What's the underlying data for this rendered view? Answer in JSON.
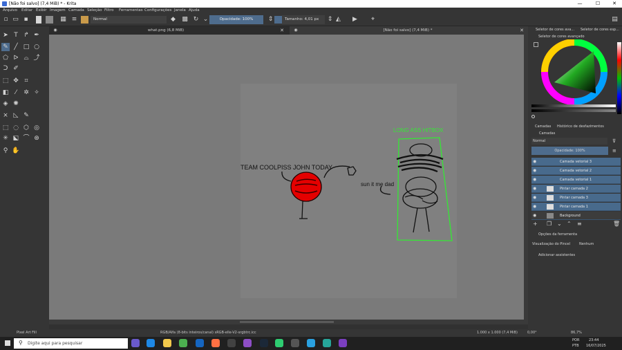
{
  "window": {
    "title": "[Não foi salvo]  (7,4 MiB)  * - Krita",
    "minimize": "—",
    "maximize": "☐",
    "close": "✕"
  },
  "menu": [
    "Arquivo",
    "Editar",
    "Exibir",
    "Imagem",
    "Camada",
    "Seleção",
    "Filtro",
    "Ferramentas",
    "Configurações",
    "Janela",
    "Ajuda"
  ],
  "toolbar": {
    "blend_mode": "Normal",
    "opacity": "Opacidade: 100%",
    "size": "Tamanho: 4,01 px"
  },
  "documents": {
    "tab1": "what.png (6,8 MiB)",
    "tab2": "[Não foi salvo]  (7,4 MiB) *"
  },
  "drawing": {
    "text_team": "TEAM COOLPISS JOHN TODAY",
    "text_sun": "sun it me dad",
    "text_hitbox": "LONG ASS HITBOX",
    "hitbox_color": "#34e834",
    "ball_color": "#e40000"
  },
  "panel": {
    "color_tabs": [
      "Seletor de cores ava...",
      "Seletor de cores esp..."
    ],
    "advanced_selector": "Seletor de cores avançado",
    "layers_tabs": [
      "Camadas",
      "Histórico de desfazimentos"
    ],
    "layers_title": "Camadas",
    "layer_blend": "Normal",
    "layer_opacity": "Opacidade:  100%",
    "layers": [
      "Camada vetorial 3",
      "Camada vetorial 2",
      "Camada vetorial 1",
      "Pintar camada 2",
      "Pintar camada 3",
      "Pintar camada 1",
      "Background"
    ],
    "tool_options_title": "Opções da ferramenta",
    "brush_preview_label": "Visualização do Pincel",
    "brush_preview_value": "Nenhum",
    "assistants": "Adicionar assistentes"
  },
  "status": {
    "tool": "Pixel Art Fill",
    "color_space": "RGB/Alfa (8-bits inteiros/canal)  sRGB-elle-V2-srgbtrc.icc",
    "dims": "1.000 x 1.000 (7,4 MiB)",
    "rotation": "0,00°",
    "zoom": "86,7%"
  },
  "taskbar": {
    "search": "Digite aqui para pesquisar",
    "lang": "POR",
    "layout": "PTB",
    "time": "23:44",
    "date": "16/07/2025"
  }
}
